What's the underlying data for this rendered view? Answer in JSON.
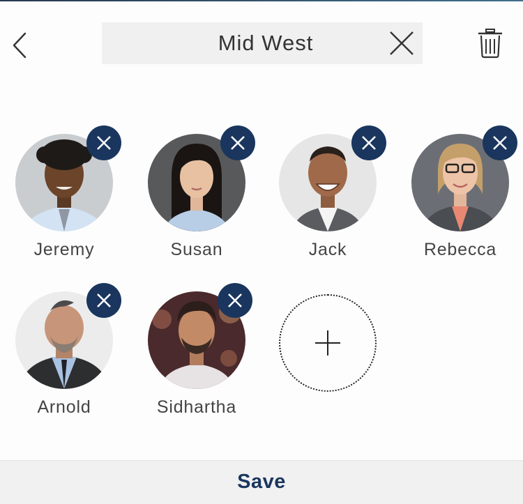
{
  "header": {
    "title": "Mid West",
    "back_icon": "chevron-left-icon",
    "clear_icon": "close-icon",
    "delete_icon": "trash-icon"
  },
  "members": [
    {
      "name": "Jeremy",
      "remove_icon": "close-icon"
    },
    {
      "name": "Susan",
      "remove_icon": "close-icon"
    },
    {
      "name": "Jack",
      "remove_icon": "close-icon"
    },
    {
      "name": "Rebecca",
      "remove_icon": "close-icon"
    },
    {
      "name": "Arnold",
      "remove_icon": "close-icon"
    },
    {
      "name": "Sidhartha",
      "remove_icon": "close-icon"
    }
  ],
  "add_member": {
    "icon": "plus-icon"
  },
  "footer": {
    "save_label": "Save"
  },
  "colors": {
    "accent": "#1a365e",
    "field_bg": "#f0f0f0",
    "footer_bg": "#f1f1f1",
    "text": "#444444"
  }
}
